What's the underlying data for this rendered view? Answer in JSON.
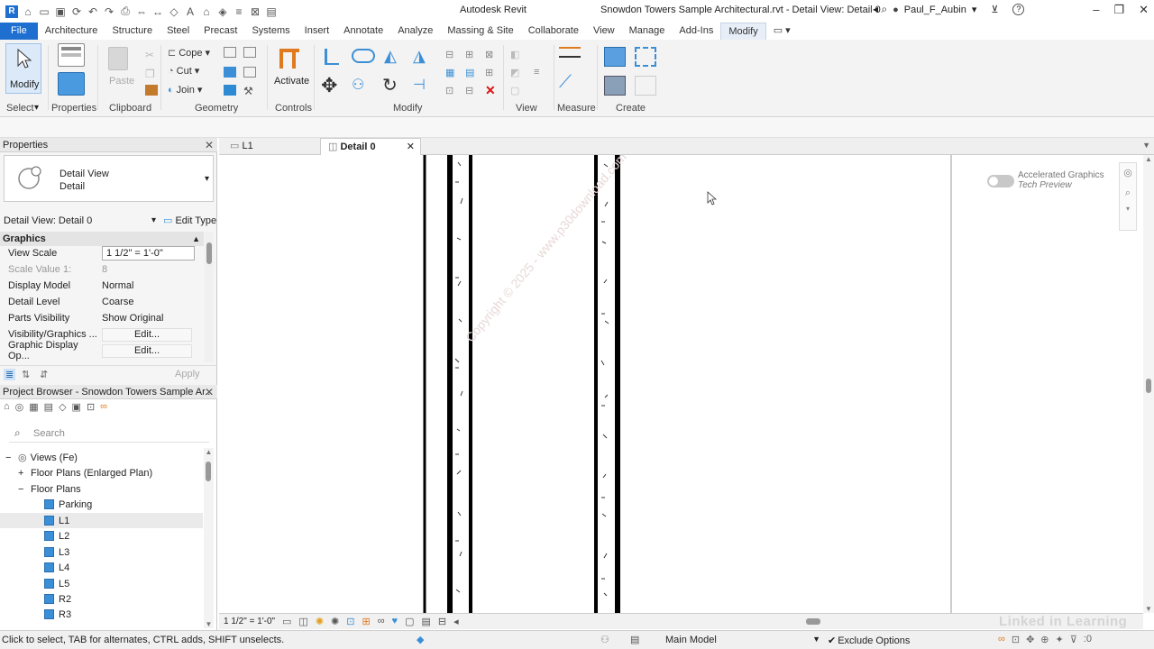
{
  "window": {
    "app_title": "Autodesk Revit",
    "file_title": "Snowdon Towers Sample Architectural.rvt - Detail View: Detail 0",
    "user": "Paul_F_Aubin"
  },
  "ribbon": {
    "tabs": [
      "File",
      "Architecture",
      "Structure",
      "Steel",
      "Precast",
      "Systems",
      "Insert",
      "Annotate",
      "Analyze",
      "Massing & Site",
      "Collaborate",
      "View",
      "Manage",
      "Add-Ins",
      "Modify"
    ],
    "active_tab": "Modify",
    "panels": {
      "select": "Select",
      "properties": "Properties",
      "clipboard": "Clipboard",
      "geometry": "Geometry",
      "controls": "Controls",
      "modify": "Modify",
      "view": "View",
      "measure": "Measure",
      "create": "Create"
    },
    "buttons": {
      "modify": "Modify",
      "paste": "Paste",
      "cope": "Cope",
      "cut": "Cut",
      "join": "Join",
      "activate": "Activate"
    }
  },
  "properties": {
    "title": "Properties",
    "type_line1": "Detail View",
    "type_line2": "Detail",
    "instance": "Detail View: Detail 0",
    "edit_type": "Edit Type",
    "group": "Graphics",
    "rows": [
      {
        "key": "View Scale",
        "value": "1 1/2\" = 1'-0\""
      },
      {
        "key": "Scale Value    1:",
        "value": "8"
      },
      {
        "key": "Display Model",
        "value": "Normal"
      },
      {
        "key": "Detail Level",
        "value": "Coarse"
      },
      {
        "key": "Parts Visibility",
        "value": "Show Original"
      },
      {
        "key": "Visibility/Graphics ...",
        "value": "Edit..."
      },
      {
        "key": "Graphic Display Op...",
        "value": "Edit..."
      }
    ],
    "apply": "Apply"
  },
  "browser": {
    "title": "Project Browser - Snowdon Towers Sample Ar...",
    "search_placeholder": "Search",
    "items": [
      {
        "label": "Views (Fe)",
        "level": 0
      },
      {
        "label": "Floor Plans (Enlarged Plan)",
        "level": 1
      },
      {
        "label": "Floor Plans",
        "level": 1
      },
      {
        "label": "Parking",
        "level": 2
      },
      {
        "label": "L1",
        "level": 2
      },
      {
        "label": "L2",
        "level": 2
      },
      {
        "label": "L3",
        "level": 2
      },
      {
        "label": "L4",
        "level": 2
      },
      {
        "label": "L5",
        "level": 2
      },
      {
        "label": "R2",
        "level": 2
      },
      {
        "label": "R3",
        "level": 2
      }
    ]
  },
  "doc_tabs": [
    "L1",
    "Detail 0"
  ],
  "canvas": {
    "accel_line1": "Accelerated Graphics",
    "accel_line2": "Tech Preview",
    "watermark": "Copyright © 2025 - www.p30download.com"
  },
  "viewbar": {
    "scale": "1 1/2\" = 1'-0\""
  },
  "status": {
    "hint": "Click to select, TAB for alternates, CTRL adds, SHIFT unselects.",
    "model": "Main Model",
    "exclude": "Exclude Options",
    "filter_count": ":0",
    "brand": "Linked in Learning"
  }
}
